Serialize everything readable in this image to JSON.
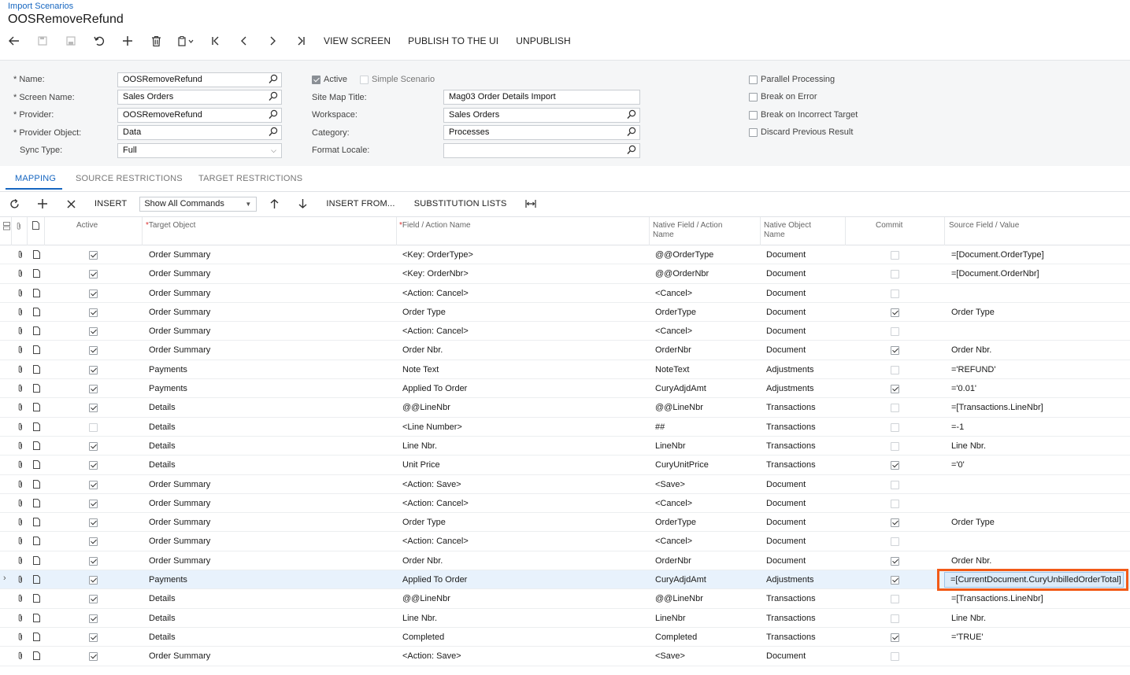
{
  "breadcrumb": "Import Scenarios",
  "title": "OOSRemoveRefund",
  "toolbar": {
    "view_screen": "VIEW SCREEN",
    "publish": "PUBLISH TO THE UI",
    "unpublish": "UNPUBLISH"
  },
  "form": {
    "name_label": "* Name:",
    "name_value": "OOSRemoveRefund",
    "screen_label": "* Screen Name:",
    "screen_value": "Sales Orders",
    "provider_label": "* Provider:",
    "provider_value": "OOSRemoveRefund",
    "provider_object_label": "* Provider Object:",
    "provider_object_value": "Data",
    "sync_label": "Sync Type:",
    "sync_value": "Full",
    "active_label": "Active",
    "simple_label": "Simple Scenario",
    "sitemap_label": "Site Map Title:",
    "sitemap_value": "Mag03 Order Details Import",
    "workspace_label": "Workspace:",
    "workspace_value": "Sales Orders",
    "category_label": "Category:",
    "category_value": "Processes",
    "locale_label": "Format Locale:",
    "locale_value": "",
    "parallel_label": "Parallel Processing",
    "break_error_label": "Break on Error",
    "break_target_label": "Break on Incorrect Target",
    "discard_label": "Discard Previous Result"
  },
  "tabs": [
    "MAPPING",
    "SOURCE RESTRICTIONS",
    "TARGET RESTRICTIONS"
  ],
  "grid_toolbar": {
    "insert": "INSERT",
    "commands_select": "Show All Commands",
    "insert_from": "INSERT FROM...",
    "substitution": "SUBSTITUTION LISTS"
  },
  "columns": {
    "active": "Active",
    "target": "Target Object",
    "field": "Field / Action Name",
    "native_field_1": "Native Field / Action",
    "native_field_2": "Name",
    "native_object_1": "Native Object",
    "native_object_2": "Name",
    "commit": "Commit",
    "source": "Source Field / Value"
  },
  "rows": [
    {
      "active": true,
      "target": "Order Summary",
      "field": "<Key: OrderType>",
      "native": "@@OrderType",
      "object": "Document",
      "commit": false,
      "source": "=[Document.OrderType]"
    },
    {
      "active": true,
      "target": "Order Summary",
      "field": "<Key: OrderNbr>",
      "native": "@@OrderNbr",
      "object": "Document",
      "commit": false,
      "source": "=[Document.OrderNbr]"
    },
    {
      "active": true,
      "target": "Order Summary",
      "field": "<Action: Cancel>",
      "native": "<Cancel>",
      "object": "Document",
      "commit": false,
      "source": ""
    },
    {
      "active": true,
      "target": "Order Summary",
      "field": "Order Type",
      "native": "OrderType",
      "object": "Document",
      "commit": true,
      "source": "Order Type"
    },
    {
      "active": true,
      "target": "Order Summary",
      "field": "<Action: Cancel>",
      "native": "<Cancel>",
      "object": "Document",
      "commit": false,
      "source": ""
    },
    {
      "active": true,
      "target": "Order Summary",
      "field": "Order Nbr.",
      "native": "OrderNbr",
      "object": "Document",
      "commit": true,
      "source": "Order Nbr."
    },
    {
      "active": true,
      "target": "Payments",
      "field": "Note Text",
      "native": "NoteText",
      "object": "Adjustments",
      "commit": false,
      "source": "='REFUND'"
    },
    {
      "active": true,
      "target": "Payments",
      "field": "Applied To Order",
      "native": "CuryAdjdAmt",
      "object": "Adjustments",
      "commit": true,
      "source": "='0.01'"
    },
    {
      "active": true,
      "target": "Details",
      "field": "@@LineNbr",
      "native": "@@LineNbr",
      "object": "Transactions",
      "commit": false,
      "source": "=[Transactions.LineNbr]"
    },
    {
      "active": false,
      "target": "Details",
      "field": "<Line Number>",
      "native": "##",
      "object": "Transactions",
      "commit": false,
      "source": "=-1"
    },
    {
      "active": true,
      "target": "Details",
      "field": "Line Nbr.",
      "native": "LineNbr",
      "object": "Transactions",
      "commit": false,
      "source": "Line Nbr."
    },
    {
      "active": true,
      "target": "Details",
      "field": "Unit Price",
      "native": "CuryUnitPrice",
      "object": "Transactions",
      "commit": true,
      "source": "='0'"
    },
    {
      "active": true,
      "target": "Order Summary",
      "field": "<Action: Save>",
      "native": "<Save>",
      "object": "Document",
      "commit": false,
      "source": ""
    },
    {
      "active": true,
      "target": "Order Summary",
      "field": "<Action: Cancel>",
      "native": "<Cancel>",
      "object": "Document",
      "commit": false,
      "source": ""
    },
    {
      "active": true,
      "target": "Order Summary",
      "field": "Order Type",
      "native": "OrderType",
      "object": "Document",
      "commit": true,
      "source": "Order Type"
    },
    {
      "active": true,
      "target": "Order Summary",
      "field": "<Action: Cancel>",
      "native": "<Cancel>",
      "object": "Document",
      "commit": false,
      "source": ""
    },
    {
      "active": true,
      "target": "Order Summary",
      "field": "Order Nbr.",
      "native": "OrderNbr",
      "object": "Document",
      "commit": true,
      "source": "Order Nbr."
    },
    {
      "active": true,
      "target": "Payments",
      "field": "Applied To Order",
      "native": "CuryAdjdAmt",
      "object": "Adjustments",
      "commit": true,
      "source": "=[CurrentDocument.CuryUnbilledOrderTotal]",
      "selected": true
    },
    {
      "active": true,
      "target": "Details",
      "field": "@@LineNbr",
      "native": "@@LineNbr",
      "object": "Transactions",
      "commit": false,
      "source": "=[Transactions.LineNbr]"
    },
    {
      "active": true,
      "target": "Details",
      "field": "Line Nbr.",
      "native": "LineNbr",
      "object": "Transactions",
      "commit": false,
      "source": "Line Nbr."
    },
    {
      "active": true,
      "target": "Details",
      "field": "Completed",
      "native": "Completed",
      "object": "Transactions",
      "commit": true,
      "source": "='TRUE'"
    },
    {
      "active": true,
      "target": "Order Summary",
      "field": "<Action: Save>",
      "native": "<Save>",
      "object": "Document",
      "commit": false,
      "source": ""
    }
  ]
}
